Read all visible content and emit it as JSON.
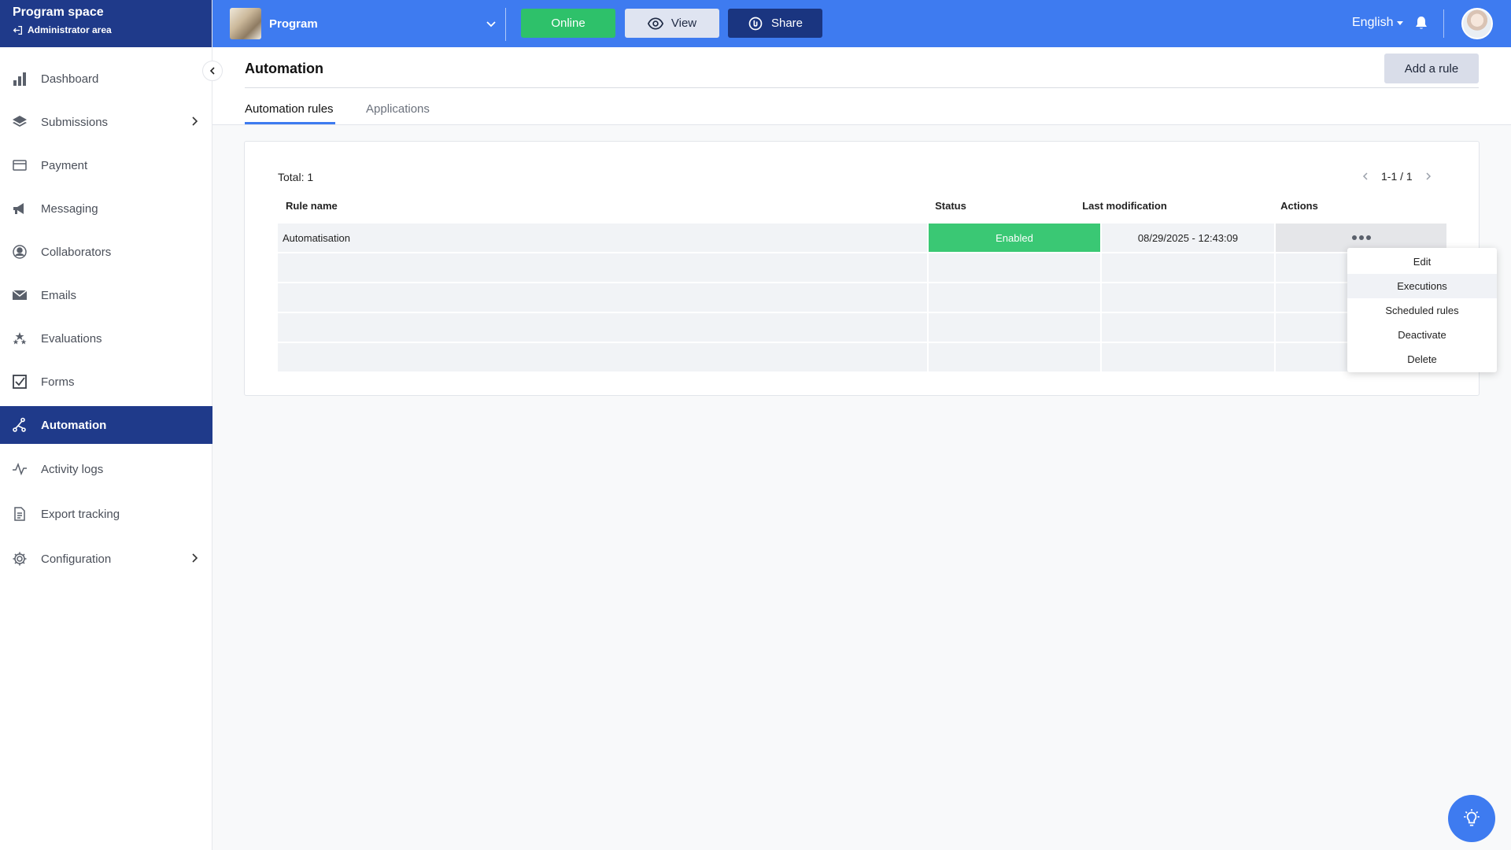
{
  "sidebar": {
    "title": "Program space",
    "subtitle": "Administrator area",
    "items": [
      {
        "label": "Dashboard"
      },
      {
        "label": "Submissions"
      },
      {
        "label": "Payment"
      },
      {
        "label": "Messaging"
      },
      {
        "label": "Collaborators"
      },
      {
        "label": "Emails"
      },
      {
        "label": "Evaluations"
      },
      {
        "label": "Forms"
      },
      {
        "label": "Automation"
      },
      {
        "label": "Activity logs"
      },
      {
        "label": "Export tracking"
      },
      {
        "label": "Configuration"
      }
    ],
    "active_item": "Automation"
  },
  "topbar": {
    "program_name": "Program",
    "online_label": "Online",
    "view_label": "View",
    "share_label": "Share",
    "language": "English",
    "accent_color": "#3e7bf0",
    "online_color": "#2ec16a"
  },
  "page": {
    "title": "Automation",
    "add_rule_label": "Add a rule",
    "tabs": [
      {
        "label": "Automation rules",
        "active": true
      },
      {
        "label": "Applications",
        "active": false
      }
    ]
  },
  "table": {
    "total": "Total: 1",
    "pagination": "1-1 / 1",
    "columns": {
      "name": "Rule name",
      "status": "Status",
      "modified": "Last modification",
      "actions": "Actions"
    },
    "rows": [
      {
        "name": "Automatisation",
        "status": "Enabled",
        "modified": "08/29/2025 - 12:43:09"
      }
    ]
  },
  "actions_menu": {
    "items": [
      {
        "label": "Edit"
      },
      {
        "label": "Executions"
      },
      {
        "label": "Scheduled rules"
      },
      {
        "label": "Deactivate"
      },
      {
        "label": "Delete"
      }
    ],
    "highlighted": "Executions"
  }
}
